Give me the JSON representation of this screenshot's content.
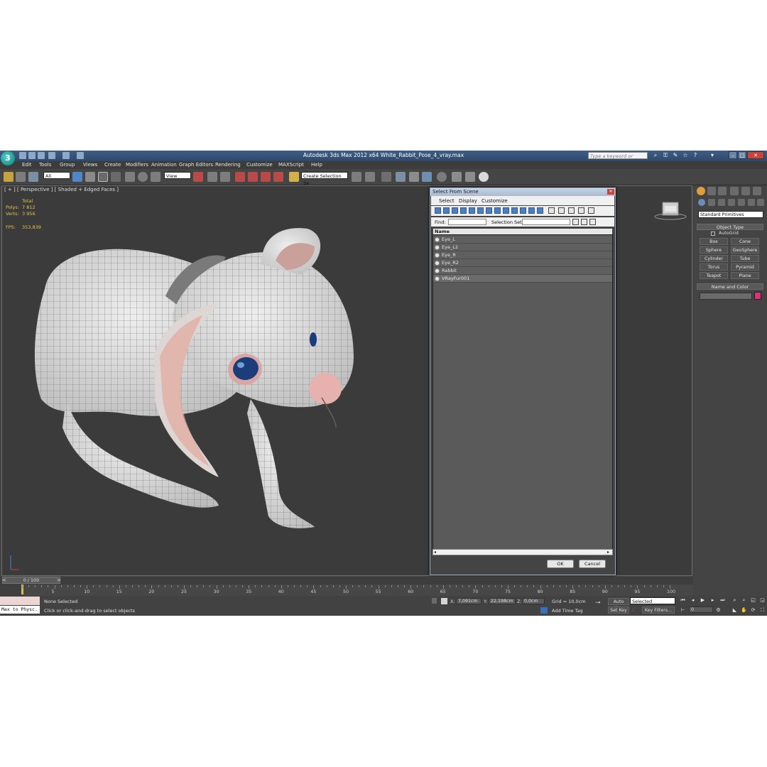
{
  "app": {
    "title": "Autodesk 3ds Max  2012 x64     White_Rabbit_Pose_4_vray.max",
    "logo_char": "3",
    "keyword_search_placeholder": "Type a keyword or phrase",
    "window_buttons": {
      "minimize": "–",
      "maximize": "□",
      "close": "✕"
    }
  },
  "menubar": [
    "Edit",
    "Tools",
    "Group",
    "Views",
    "Create",
    "Modifiers",
    "Animation",
    "Graph Editors",
    "Rendering",
    "Customize",
    "MAXScript",
    "Help"
  ],
  "toolbar": {
    "selection_filter": "All",
    "reference_coord": "View",
    "named_selection_set": "Create Selection Se"
  },
  "viewport": {
    "label": "[ + ] [ Perspective ] [ Shaded + Edged Faces ]",
    "stats": {
      "total_label": "Total",
      "polys_label": "Polys:",
      "polys_value": "7 812",
      "verts_label": "Verts:",
      "verts_value": "3 956",
      "fps_label": "FPS:",
      "fps_value": "353,839"
    }
  },
  "select_dialog": {
    "title": "Select From Scene",
    "close": "✕",
    "menus": [
      "Select",
      "Display",
      "Customize"
    ],
    "find_label": "Find:",
    "find_value": "",
    "selection_set_label": "Selection Set:",
    "list_header": "Name",
    "objects": [
      {
        "name": "Eye_L",
        "selected": false
      },
      {
        "name": "Eye_L2",
        "selected": false
      },
      {
        "name": "Eye_R",
        "selected": false
      },
      {
        "name": "Eye_R2",
        "selected": false
      },
      {
        "name": "Rabbit",
        "selected": false
      },
      {
        "name": "VRayFur001",
        "selected": true
      }
    ],
    "ok": "OK",
    "cancel": "Cancel"
  },
  "command_panel": {
    "category": "Standard Primitives",
    "object_type_title": "Object Type",
    "autogrid_label": "AutoGrid",
    "buttons": [
      "Box",
      "Cone",
      "Sphere",
      "GeoSphere",
      "Cylinder",
      "Tube",
      "Torus",
      "Pyramid",
      "Teapot",
      "Plane"
    ],
    "name_color_title": "Name and Color",
    "name_value": "",
    "swatch_color": "#e0307a"
  },
  "timeline": {
    "frame_display": "0 / 100",
    "ticks": [
      "5",
      "10",
      "15",
      "20",
      "25",
      "30",
      "35",
      "40",
      "45",
      "50",
      "55",
      "60",
      "65",
      "70",
      "75",
      "80",
      "85",
      "90",
      "95",
      "100"
    ]
  },
  "status": {
    "maxscript_listener": "Max to Physc.",
    "selection": "None Selected",
    "prompt": "Click or click-and-drag to select objects",
    "x_label": "X:",
    "x_value": "7,091cm",
    "y_label": "Y:",
    "y_value": "22,198cm",
    "z_label": "Z:",
    "z_value": "0,0cm",
    "grid": "Grid = 10,0cm",
    "add_time_tag": "Add Time Tag",
    "auto_key": "Auto Key",
    "set_key": "Set Key",
    "key_mode": "Selected",
    "key_filters": "Key Filters...",
    "current_frame": "0"
  },
  "colors": {
    "titlebar": "#3a5a82",
    "viewport_bg": "#3b3b3b",
    "stats_text": "#e8c34a",
    "panel_bg": "#444444",
    "dialog_list_bg": "#5a5a5a"
  }
}
